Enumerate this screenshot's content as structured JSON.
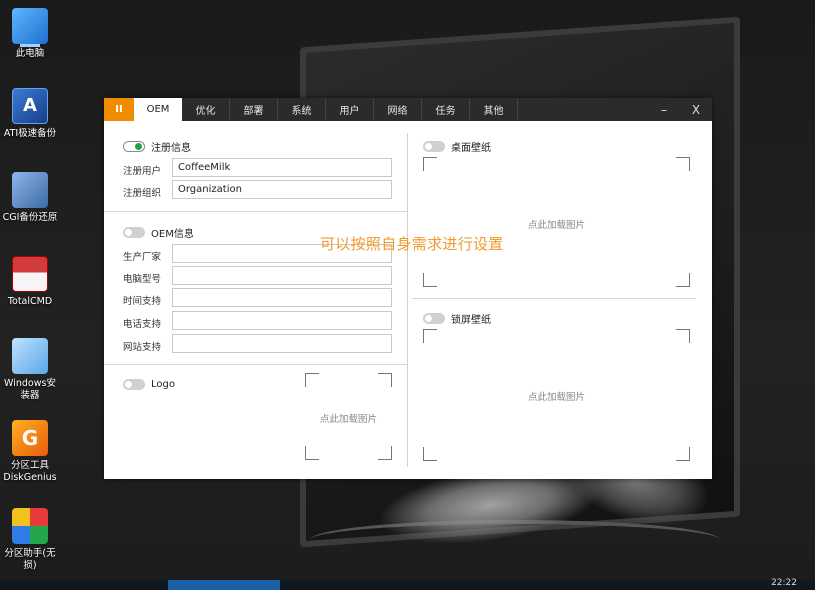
{
  "desktop": {
    "icons": [
      {
        "label": "此电脑"
      },
      {
        "label": "ATI极速备份",
        "glyph": "A"
      },
      {
        "label": "CGI备份还原"
      },
      {
        "label": "TotalCMD"
      },
      {
        "label": "Windows安装器"
      },
      {
        "label": "分区工具DiskGenius",
        "glyph": "G"
      },
      {
        "label": "分区助手(无损)"
      }
    ]
  },
  "taskbar": {
    "clock": "22:22"
  },
  "window": {
    "logo": "II",
    "tabs": [
      {
        "label": "OEM"
      },
      {
        "label": "优化"
      },
      {
        "label": "部署"
      },
      {
        "label": "系统"
      },
      {
        "label": "用户"
      },
      {
        "label": "网络"
      },
      {
        "label": "任务"
      },
      {
        "label": "其他"
      }
    ],
    "controls": {
      "minimize": "–",
      "close": "X"
    },
    "overlay_note": "可以按照自身需求进行设置",
    "left": {
      "register": {
        "toggle_label": "注册信息",
        "enabled": true,
        "fields": [
          {
            "label": "注册用户",
            "value": "CoffeeMilk"
          },
          {
            "label": "注册组织",
            "value": "Organization"
          }
        ]
      },
      "oem": {
        "toggle_label": "OEM信息",
        "enabled": false,
        "fields": [
          {
            "label": "生产厂家",
            "value": ""
          },
          {
            "label": "电脑型号",
            "value": ""
          },
          {
            "label": "时间支持",
            "value": ""
          },
          {
            "label": "电话支持",
            "value": ""
          },
          {
            "label": "网站支持",
            "value": ""
          }
        ]
      },
      "logo": {
        "toggle_label": "Logo",
        "enabled": false,
        "drop_hint": "点此加载图片"
      }
    },
    "right": {
      "desktop_wallpaper": {
        "toggle_label": "桌面壁纸",
        "enabled": false,
        "drop_hint": "点此加载图片"
      },
      "lock_wallpaper": {
        "toggle_label": "锁屏壁纸",
        "enabled": false,
        "drop_hint": "点此加载图片"
      }
    }
  }
}
